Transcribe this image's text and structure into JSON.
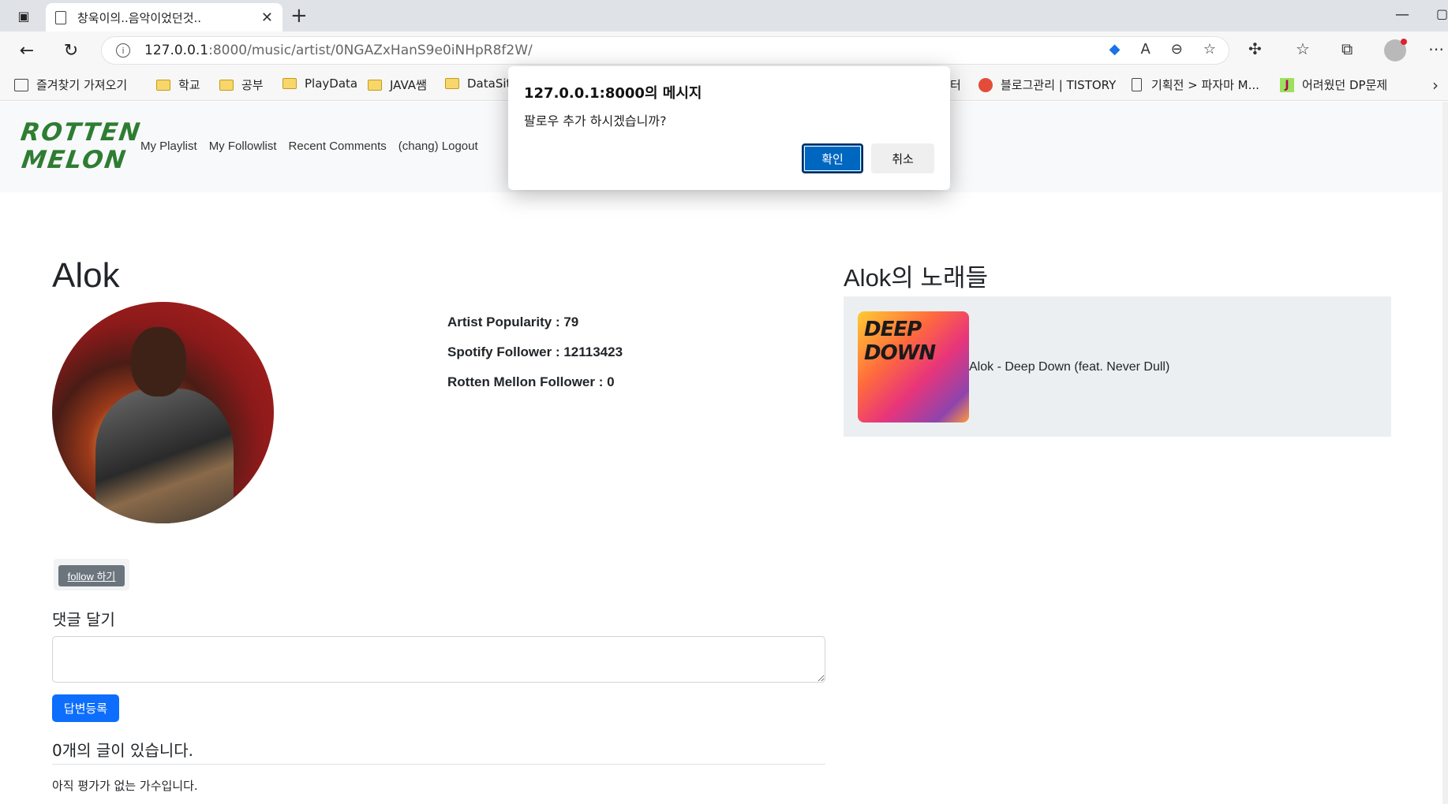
{
  "browser": {
    "tab_title": "창욱이의..음악이었던것..",
    "url_host": "127.0.0.1",
    "url_rest": ":8000/music/artist/0NGAZxHanS9e0iNHpR8f2W/"
  },
  "bookmarks": [
    {
      "label": "즐겨찾기 가져오기",
      "icon": "import-icon"
    },
    {
      "label": "학교",
      "icon": "folder-icon"
    },
    {
      "label": "공부",
      "icon": "folder-icon"
    },
    {
      "label": "PlayData",
      "icon": "folder-icon"
    },
    {
      "label": "JAVA쌤",
      "icon": "folder-icon"
    },
    {
      "label": "DataSite",
      "icon": "folder-icon"
    },
    {
      "label": "터",
      "icon": ""
    },
    {
      "label": "블로그관리 | TISTORY",
      "icon": "tistory-icon"
    },
    {
      "label": "기획전 > 파자마 M...",
      "icon": "document-icon"
    },
    {
      "label": "어려웠던 DP문제",
      "icon": "j-icon"
    }
  ],
  "site": {
    "logo_line1": "ROTTEN",
    "logo_line2": "MELON",
    "logo_color": "#2e7d32",
    "nav": [
      "My Playlist",
      "My Followlist",
      "Recent Comments",
      "(chang) Logout"
    ]
  },
  "artist": {
    "name": "Alok",
    "popularity": "Artist Popularity : 79",
    "spotify_followers": "Spotify Follower : 12113423",
    "rotten_followers": "Rotten Mellon Follower : 0"
  },
  "follow_button": "follow 하기",
  "comments": {
    "title": "댓글 달기",
    "submit_label": "답변등록",
    "count_text": "0개의 글이 있습니다.",
    "empty_text": "아직 평가가 없는 가수입니다."
  },
  "songs": {
    "title": "Alok의 노래들",
    "items": [
      {
        "cover_text": "DEEP DOWN",
        "label": "Alok - Deep Down (feat. Never Dull)"
      }
    ]
  },
  "dialog": {
    "title": "127.0.0.1:8000의 메시지",
    "message": "팔로우 추가 하시겠습니까?",
    "ok_label": "확인",
    "cancel_label": "취소"
  }
}
